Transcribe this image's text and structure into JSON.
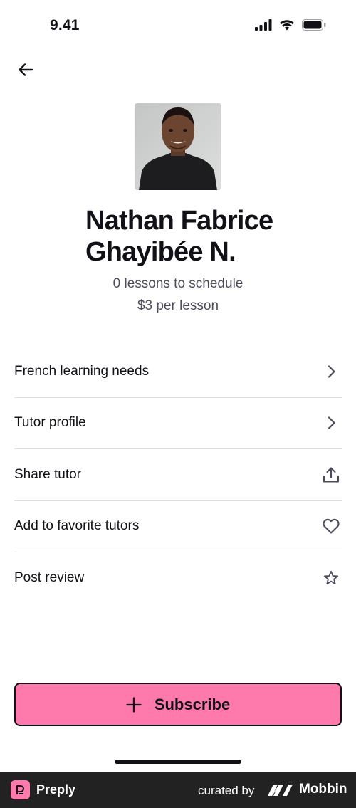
{
  "status_bar": {
    "time": "9.41"
  },
  "tutor": {
    "name": "Nathan Fabrice Ghayibée N.",
    "lessons_to_schedule": "0 lessons to schedule",
    "price": "$3 per lesson"
  },
  "menu": {
    "items": [
      {
        "label": "French learning needs",
        "icon": "chevron-right-icon"
      },
      {
        "label": "Tutor profile",
        "icon": "chevron-right-icon"
      },
      {
        "label": "Share tutor",
        "icon": "share-upload-icon"
      },
      {
        "label": "Add to favorite tutors",
        "icon": "heart-icon"
      },
      {
        "label": "Post review",
        "icon": "star-icon"
      }
    ]
  },
  "subscribe": {
    "label": "Subscribe"
  },
  "footer": {
    "preply_label": "Preply",
    "curated_by": "curated by",
    "mobbin_label": "Mobbin"
  },
  "colors": {
    "accent_pink": "#ff7aac",
    "text_primary": "#121117",
    "text_secondary": "#4d4c5c",
    "divider": "#dcdce5",
    "footer_bg": "#222222"
  }
}
